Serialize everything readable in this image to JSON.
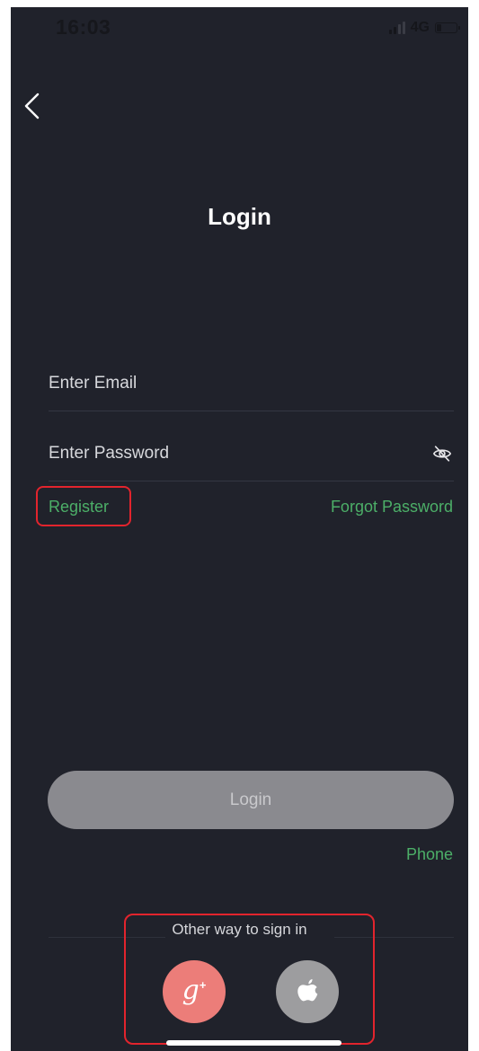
{
  "status_bar": {
    "time": "16:03",
    "network": "4G",
    "battery_level": 0.25
  },
  "header": {
    "back_icon": "chevron-left-icon",
    "title": "Login"
  },
  "form": {
    "email_placeholder": "Enter Email",
    "email_value": "",
    "password_placeholder": "Enter Password",
    "password_value": "",
    "password_toggle_icon": "eye-off-icon"
  },
  "links": {
    "register": "Register",
    "forgot_password": "Forgot Password",
    "phone": "Phone"
  },
  "login_button": {
    "label": "Login"
  },
  "social": {
    "label": "Other way to sign in",
    "google_icon": "google-plus-icon",
    "apple_icon": "apple-icon"
  },
  "colors": {
    "background": "#20222b",
    "accent": "#4caf68",
    "login_button": "#8a8a8f",
    "google": "#ec7d79",
    "apple": "#9d9d9f",
    "highlight": "#e2242d"
  }
}
